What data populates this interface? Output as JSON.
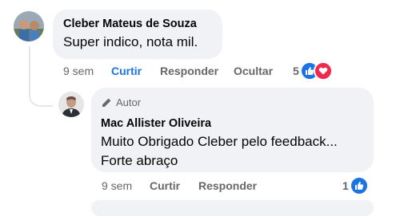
{
  "comment1": {
    "author": "Cleber Mateus de Souza",
    "text": "Super indico, nota mil.",
    "actions": {
      "time": "9 sem",
      "like": "Curtir",
      "reply": "Responder",
      "hide": "Ocultar"
    },
    "reactions": {
      "count": "5",
      "icons": [
        "like-icon",
        "love-icon"
      ]
    }
  },
  "reply1": {
    "author_tag": "Autor",
    "author": "Mac Allister Oliveira",
    "text_line1": "Muito Obrigado Cleber pelo feedback...",
    "text_line2": "Forte abraço",
    "actions": {
      "time": "9 sem",
      "like": "Curtir",
      "reply": "Responder"
    },
    "reactions": {
      "count": "1",
      "icons": [
        "like-icon"
      ]
    }
  },
  "colors": {
    "bubble": "#f0f2f5",
    "secondary_text": "#65676b",
    "like_blue": "#1b74e4",
    "love_red": "#f0284a"
  }
}
